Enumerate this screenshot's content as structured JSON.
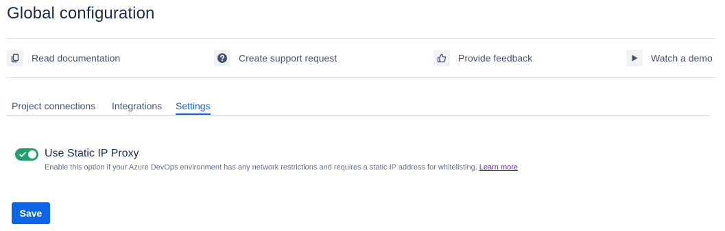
{
  "page": {
    "title": "Global configuration"
  },
  "resources": [
    {
      "label": "Read documentation",
      "icon": "document-copy-icon"
    },
    {
      "label": "Create support request",
      "icon": "question-circle-icon"
    },
    {
      "label": "Provide feedback",
      "icon": "thumbs-up-icon"
    },
    {
      "label": "Watch a demo",
      "icon": "play-icon"
    }
  ],
  "tabs": [
    {
      "label": "Project connections",
      "active": false
    },
    {
      "label": "Integrations",
      "active": false
    },
    {
      "label": "Settings",
      "active": true
    }
  ],
  "setting": {
    "title": "Use Static IP Proxy",
    "description": "Enable this option if your Azure DevOps environment has any network restrictions and requires a static IP address for whitelisting.",
    "learn_more": "Learn more",
    "enabled": true
  },
  "actions": {
    "save_label": "Save"
  },
  "colors": {
    "primary": "#0c66e4",
    "toggle_on": "#22a06b",
    "link_visited": "#5e2ca5",
    "text": "#172b4d",
    "subtle_text": "#42526e"
  }
}
